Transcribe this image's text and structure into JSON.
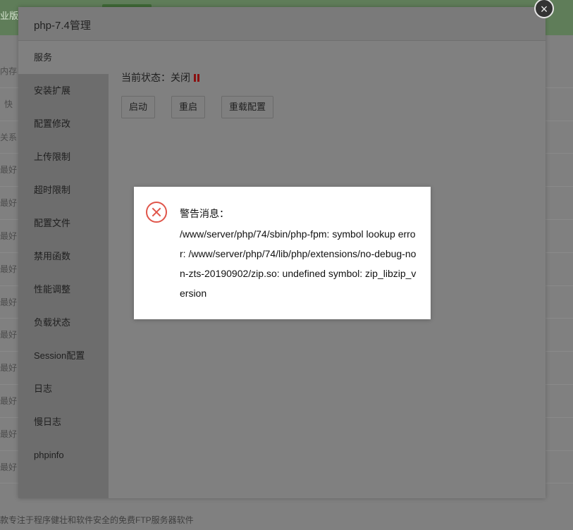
{
  "background": {
    "topbar_label": "业版",
    "row_labels": [
      "内存",
      "快",
      "关系",
      "最好",
      "最好",
      "最好",
      "最好",
      "最好",
      "最好",
      "最好",
      "最好",
      "最好",
      "最好"
    ],
    "footer_text": "款专注于程序健壮和软件安全的免费FTP服务器软件"
  },
  "modal": {
    "title": "php-7.4管理",
    "close_icon": "×",
    "sidebar": [
      "服务",
      "安装扩展",
      "配置修改",
      "上传限制",
      "超时限制",
      "配置文件",
      "禁用函数",
      "性能调整",
      "负载状态",
      "Session配置",
      "日志",
      "慢日志",
      "phpinfo"
    ],
    "status": {
      "label": "当前状态：关闭"
    },
    "buttons": {
      "start": "启动",
      "restart": "重启",
      "reload": "重载配置"
    }
  },
  "alert": {
    "title": "警告消息：",
    "message": "/www/server/php/74/sbin/php-fpm: symbol lookup error: /www/server/php/74/lib/php/extensions/no-debug-non-zts-20190902/zip.so: undefined symbol: zip_libzip_version"
  },
  "colors": {
    "error_red": "#e0554a",
    "stopped_status": "#8a0f0f"
  }
}
